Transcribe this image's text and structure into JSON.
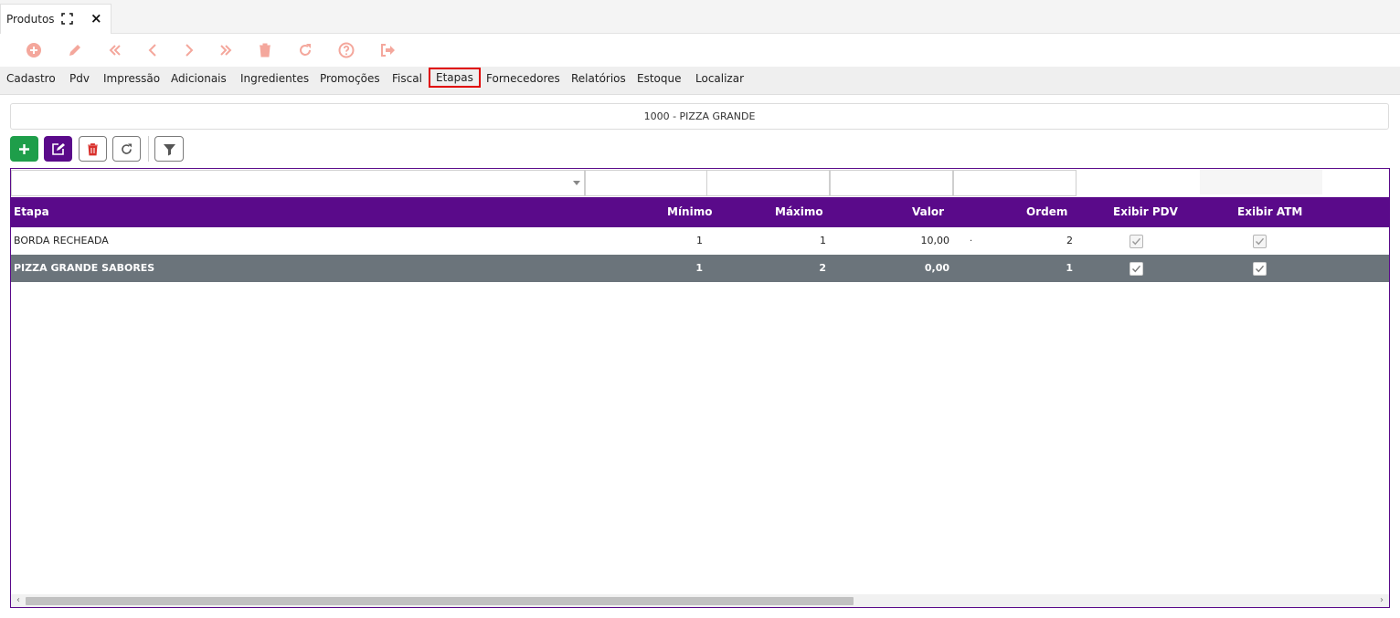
{
  "window_tab": {
    "title": "Produtos"
  },
  "section_tabs": [
    "Cadastro",
    "Pdv",
    "Impressão",
    "Adicionais",
    "Ingredientes",
    "Promoções",
    "Fiscal",
    "Etapas",
    "Fornecedores",
    "Relatórios",
    "Estoque",
    "Localizar"
  ],
  "active_tab": "Etapas",
  "product": {
    "title": "1000 - PIZZA GRANDE"
  },
  "grid": {
    "columns": {
      "etapa": "Etapa",
      "minimo": "Mínimo",
      "maximo": "Máximo",
      "valor": "Valor",
      "ordem": "Ordem",
      "exibir_pdv": "Exibir PDV",
      "exibir_atm": "Exibir ATM"
    },
    "rows": [
      {
        "etapa": "BORDA RECHEADA",
        "minimo": "1",
        "maximo": "1",
        "valor": "10,00",
        "ordem": "2",
        "exibir_pdv": true,
        "exibir_atm": true,
        "selected": false
      },
      {
        "etapa": "PIZZA GRANDE SABORES",
        "minimo": "1",
        "maximo": "2",
        "valor": "0,00",
        "ordem": "1",
        "exibir_pdv": true,
        "exibir_atm": true,
        "selected": true
      }
    ]
  },
  "colors": {
    "accent": "#5a0a8a",
    "selected_row": "#6b747b",
    "add_button": "#1e9e4a",
    "delete_icon": "#d9302c",
    "action_icons": "#f4a79c",
    "active_tab_border": "#e00000"
  },
  "icons": {
    "actionbar": [
      "plus-circle-icon",
      "pencil-icon",
      "first-page-icon",
      "previous-icon",
      "next-icon",
      "last-page-icon",
      "trash-icon",
      "refresh-icon",
      "help-icon",
      "exit-icon"
    ],
    "grid_toolbar": [
      "plus-icon",
      "edit-icon",
      "trash-icon",
      "refresh-icon",
      "filter-icon"
    ]
  }
}
